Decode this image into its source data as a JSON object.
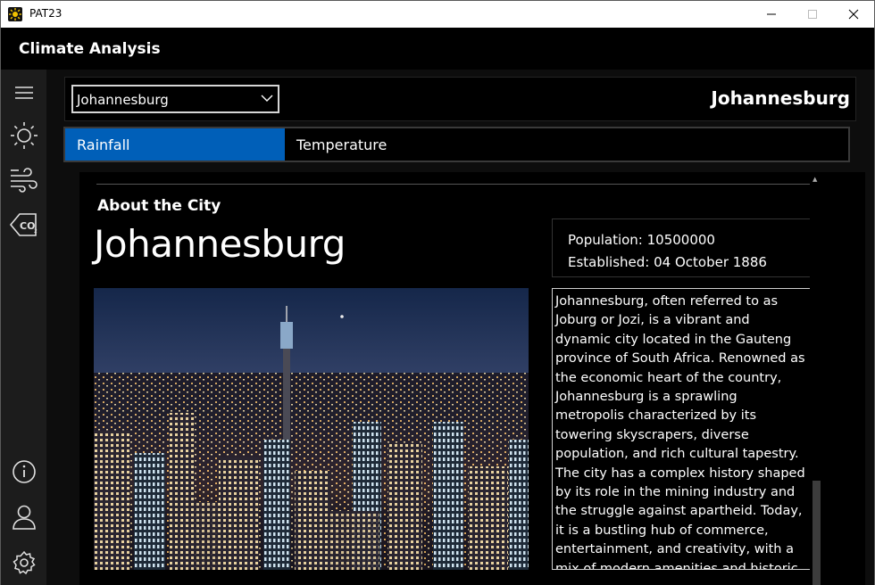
{
  "window": {
    "title": "PAT23",
    "minimize": "—",
    "maximize": "☐",
    "close": "✕"
  },
  "header": {
    "app_title": "Climate Analysis"
  },
  "rail": {
    "top_icons": [
      "menu-icon",
      "sun-icon",
      "wind-icon",
      "co2-icon"
    ],
    "bottom_icons": [
      "info-icon",
      "user-icon",
      "settings-icon"
    ]
  },
  "topbar": {
    "selected_city": "Johannesburg",
    "city_heading": "Johannesburg"
  },
  "tabs": [
    {
      "label": "Rainfall",
      "selected": true
    },
    {
      "label": "Temperature",
      "selected": false
    }
  ],
  "about": {
    "section_label": "About the City",
    "city_name": "Johannesburg",
    "population": "Population: 10500000",
    "established": "Established: 04 October 1886",
    "description": "Johannesburg, often referred to as Joburg or Jozi, is a vibrant and dynamic city located in the Gauteng province of South Africa. Renowned as the economic heart of the country, Johannesburg is a sprawling metropolis characterized by its towering skyscrapers, diverse population, and rich cultural tapestry. The city has a complex history shaped by its role in the mining industry and the struggle against apartheid. Today, it is a bustling hub of commerce, entertainment, and creativity, with a mix of modern amenities and historic sites that reflect"
  },
  "colors": {
    "accent": "#005fb8",
    "background": "#000000",
    "rail": "#1c1c1c"
  }
}
